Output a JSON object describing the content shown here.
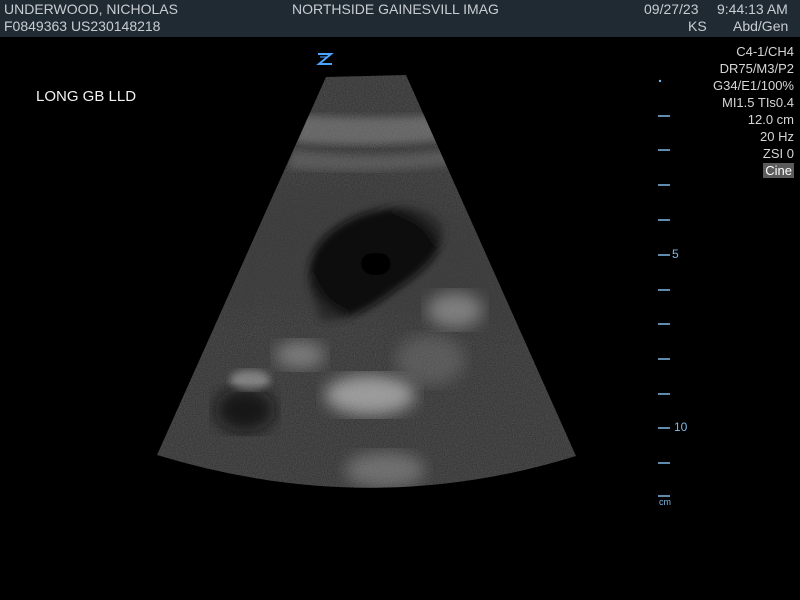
{
  "header": {
    "patient_name": "UNDERWOOD, NICHOLAS",
    "patient_id": "F0849363  US230148218",
    "institution": "NORTHSIDE GAINESVILL IMAG",
    "date": "09/27/23",
    "time": "9:44:13 AM",
    "operator": "KS",
    "preset": "Abd/Gen",
    "background_color": "#1f2a33"
  },
  "image_label": "LONG GB LLD",
  "orientation_marker": {
    "icon": "z-orientation-icon",
    "color": "#4aa3ff"
  },
  "params": {
    "probe": "C4-1/CH4",
    "dr": "DR75/M3/P2",
    "gain": "G34/E1/100%",
    "mi_tis": "MI1.5  TIs0.4",
    "depth": "12.0 cm",
    "frame_rate": "20 Hz",
    "zsi": "ZSI 0",
    "cine": "Cine"
  },
  "depth_scale": {
    "labels": [
      "5",
      "10"
    ],
    "unit": "cm",
    "color": "#7fb8e6"
  }
}
